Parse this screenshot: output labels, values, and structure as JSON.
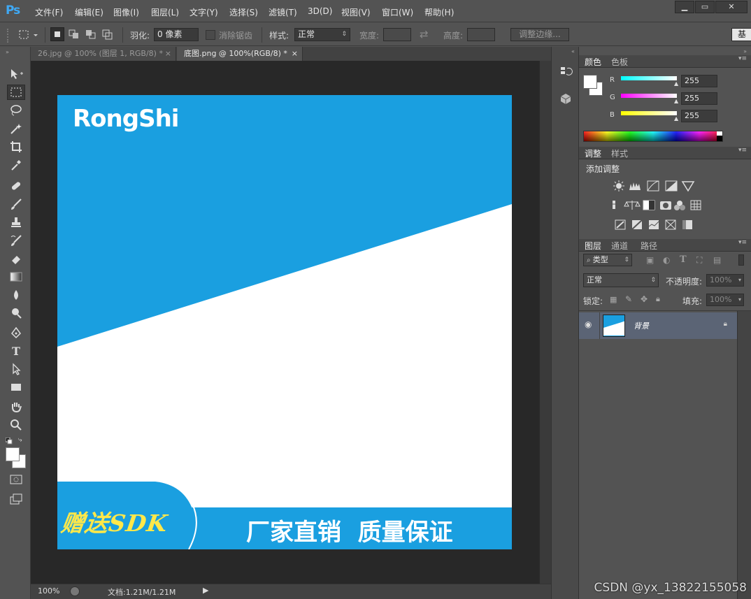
{
  "app": {
    "logo": "Ps"
  },
  "menu": [
    "文件(F)",
    "编辑(E)",
    "图像(I)",
    "图层(L)",
    "文字(Y)",
    "选择(S)",
    "滤镜(T)",
    "3D(D)",
    "视图(V)",
    "窗口(W)",
    "帮助(H)"
  ],
  "window_buttons": {
    "minimize": "▁",
    "restore": "▭",
    "close": "✕"
  },
  "options": {
    "feather_label": "羽化:",
    "feather_value": "0 像素",
    "antialias_label": "消除锯齿",
    "style_label": "样式:",
    "style_value": "正常",
    "width_label": "宽度:",
    "height_label": "高度:",
    "refine_edge": "调整边缘...",
    "workspace_btn": "基"
  },
  "tabs": [
    {
      "label": "26.jpg @ 100% (图层 1, RGB/8) *",
      "close": "×"
    },
    {
      "label": "底图.png @ 100%(RGB/8) *",
      "close": "×"
    }
  ],
  "canvas": {
    "brand": "RongShi",
    "gift": "赠送SDK",
    "slogan": "厂家直销  质量保证",
    "blue": "#1a9fe0",
    "gift_color": "#ffe84a"
  },
  "status": {
    "zoom": "100%",
    "doc": "文档:1.21M/1.21M"
  },
  "watermark": "CSDN @yx_13822155058",
  "color_panel": {
    "tabs": [
      "颜色",
      "色板"
    ],
    "channels": [
      {
        "label": "R",
        "value": "255"
      },
      {
        "label": "G",
        "value": "255"
      },
      {
        "label": "B",
        "value": "255"
      }
    ]
  },
  "adjust_panel": {
    "tabs": [
      "调整",
      "样式"
    ],
    "title": "添加调整"
  },
  "layers_panel": {
    "tabs": [
      "图层",
      "通道",
      "路径"
    ],
    "filter_kind": "类型",
    "blend_mode": "正常",
    "opacity_label": "不透明度:",
    "opacity_value": "100%",
    "lock_label": "锁定:",
    "fill_label": "填充:",
    "fill_value": "100%",
    "layers": [
      {
        "name": "背景"
      }
    ]
  }
}
